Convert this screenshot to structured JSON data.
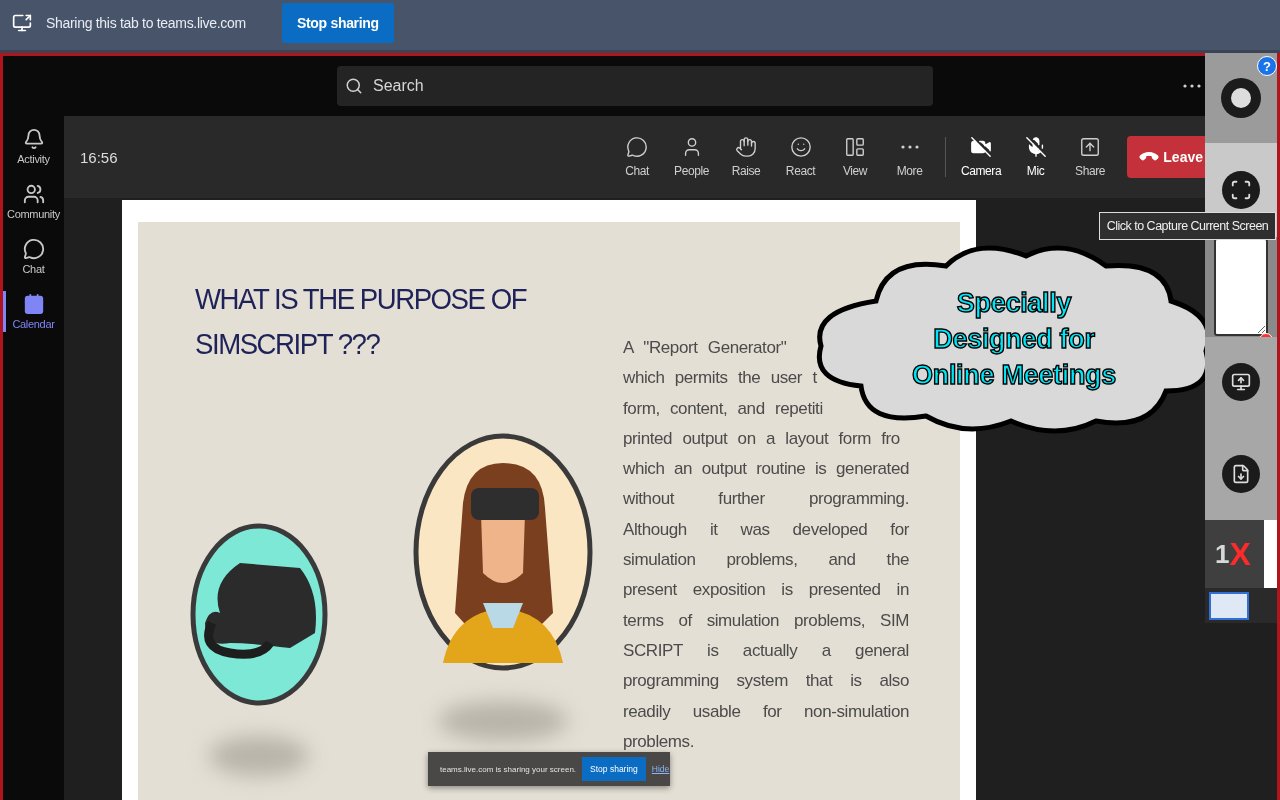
{
  "share_bar": {
    "message": "Sharing this tab to teams.live.com",
    "button": "Stop sharing"
  },
  "search": {
    "placeholder": "Search"
  },
  "rail": [
    {
      "label": "Activity",
      "kind": "bell",
      "selected": false
    },
    {
      "label": "Community",
      "kind": "people",
      "selected": false
    },
    {
      "label": "Chat",
      "kind": "chat",
      "selected": false
    },
    {
      "label": "Calendar",
      "kind": "calendar",
      "selected": true
    }
  ],
  "meeting": {
    "time": "16:56",
    "actions": [
      {
        "label": "Chat",
        "kind": "chat",
        "off": false
      },
      {
        "label": "People",
        "kind": "person",
        "off": false
      },
      {
        "label": "Raise",
        "kind": "hand",
        "off": false
      },
      {
        "label": "React",
        "kind": "smile",
        "off": false
      },
      {
        "label": "View",
        "kind": "layout",
        "off": false
      },
      {
        "label": "More",
        "kind": "more",
        "off": false
      },
      {
        "label": "Camera",
        "kind": "camera",
        "off": true
      },
      {
        "label": "Mic",
        "kind": "mic",
        "off": true
      },
      {
        "label": "Share",
        "kind": "share",
        "off": false
      }
    ],
    "leave": "Leave"
  },
  "slide": {
    "title": "WHAT IS THE PURPOSE OF SIMSCRIPT ???",
    "lines": [
      {
        "text": "A \"Report Generator\"",
        "kind": "cut"
      },
      {
        "text": "which permits the user t",
        "kind": "cut"
      },
      {
        "text": "form, content, and repetiti",
        "kind": "cut"
      },
      {
        "text": "printed output on a layout form fro",
        "kind": "cut"
      },
      {
        "text": "which an output routine is generated",
        "kind": "full"
      },
      {
        "text": "without further programming.",
        "kind": "full"
      },
      {
        "text": "Although it was developed for",
        "kind": "full"
      },
      {
        "text": "simulation problems, and the",
        "kind": "full"
      },
      {
        "text": "present exposition is presented in",
        "kind": "full"
      },
      {
        "text": "terms of simulation problems, SIM",
        "kind": "full"
      },
      {
        "text": "SCRIPT is actually a general",
        "kind": "full"
      },
      {
        "text": "programming system that is also",
        "kind": "full"
      },
      {
        "text": "readily usable for non-simulation",
        "kind": "full"
      },
      {
        "text": "problems.",
        "kind": "last"
      }
    ]
  },
  "share_notice": {
    "message": "teams.live.com is sharing your screen.",
    "button": "Stop sharing",
    "link": "Hide"
  },
  "callout": {
    "lines": [
      "Specially",
      "Designed for",
      "Online Meetings"
    ]
  },
  "extension": {
    "help": "?",
    "tooltip": "Click to Capture Current Screen",
    "counter": "1",
    "close": "X"
  }
}
